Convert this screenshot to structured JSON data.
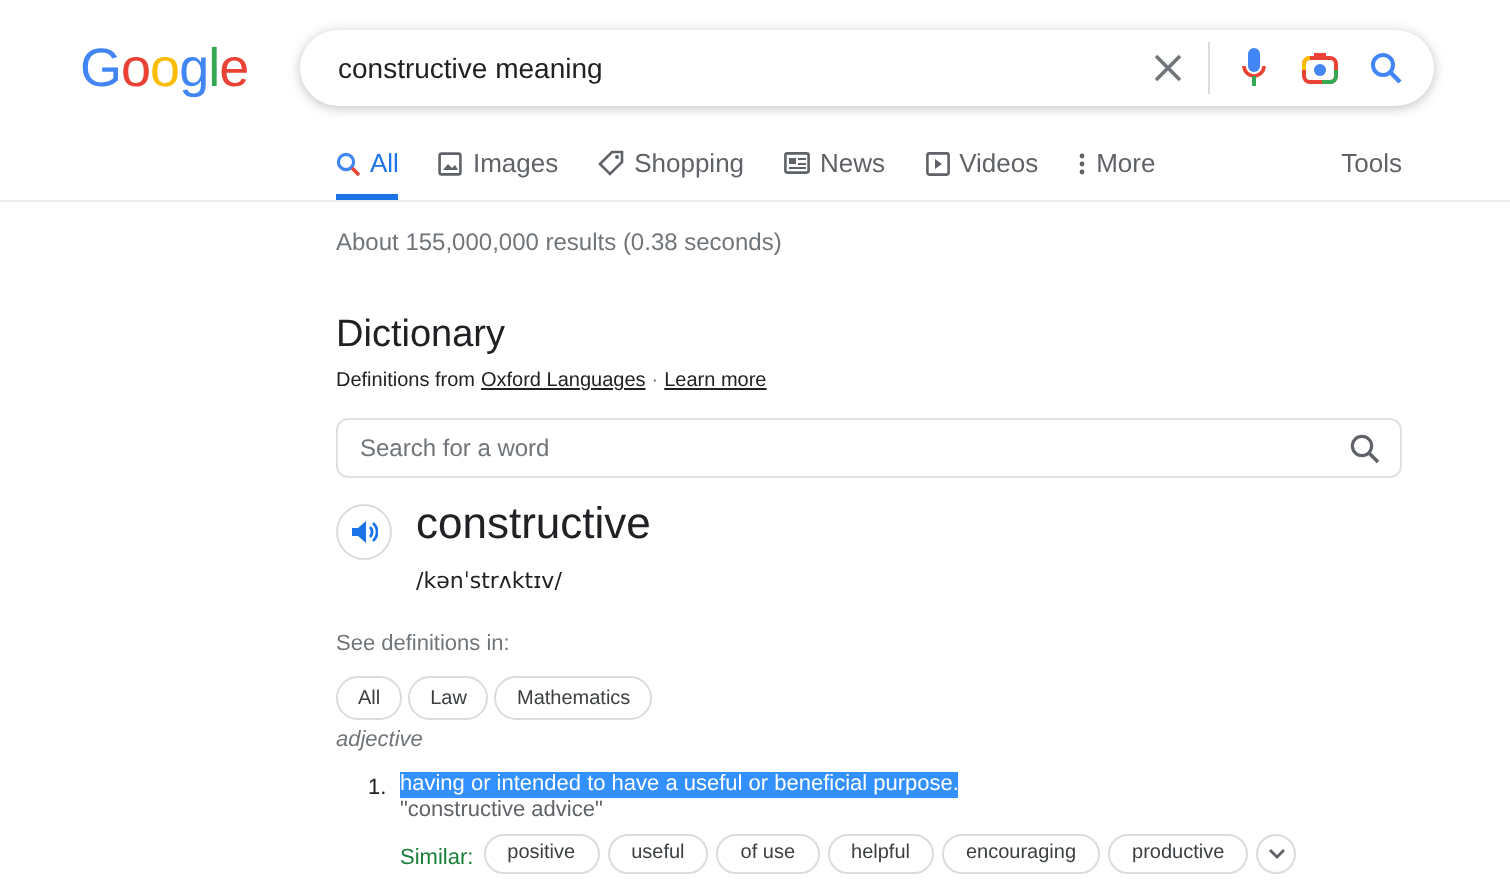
{
  "logo": "Google",
  "search": {
    "value": "constructive meaning"
  },
  "tabs": [
    {
      "label": "All",
      "kind": "all",
      "selected": true
    },
    {
      "label": "Images",
      "kind": "images",
      "selected": false
    },
    {
      "label": "Shopping",
      "kind": "shopping",
      "selected": false
    },
    {
      "label": "News",
      "kind": "news",
      "selected": false
    },
    {
      "label": "Videos",
      "kind": "videos",
      "selected": false
    },
    {
      "label": "More",
      "kind": "more",
      "selected": false
    }
  ],
  "tools": "Tools",
  "result_stats": "About 155,000,000 results (0.38 seconds)",
  "dictionary": {
    "title": "Dictionary",
    "source_prefix": "Definitions from",
    "source_link": "Oxford Languages",
    "separator": "·",
    "learn_more": "Learn more",
    "word_search": {
      "placeholder": "Search for a word"
    },
    "word": "constructive",
    "phonetic": "/kənˈstrʌktɪv/",
    "see_in_label": "See definitions in:",
    "domains": [
      {
        "label": "All"
      },
      {
        "label": "Law"
      },
      {
        "label": "Mathematics"
      }
    ],
    "part_of_speech": "adjective",
    "definitions": [
      {
        "number": "1.",
        "text": "having or intended to have a useful or beneficial purpose.",
        "highlighted": true,
        "example": "\"constructive advice\"",
        "similar_label": "Similar:",
        "similar": [
          "positive",
          "useful",
          "of use",
          "helpful",
          "encouraging",
          "productive"
        ]
      }
    ]
  }
}
